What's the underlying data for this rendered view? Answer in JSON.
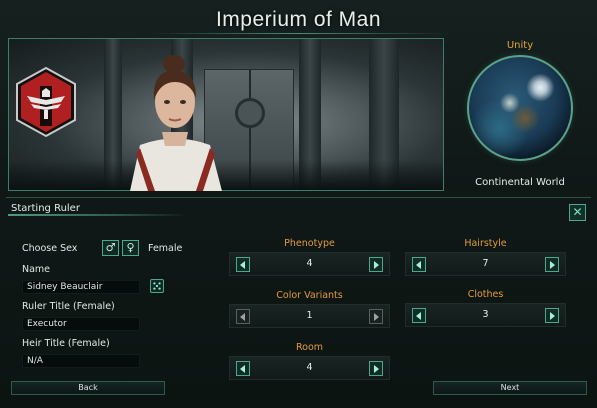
{
  "window": {
    "title": "Imperium of Man"
  },
  "planet": {
    "name": "Unity",
    "type": "Continental World"
  },
  "section": {
    "title": "Starting Ruler",
    "close_label": "✕"
  },
  "sex": {
    "label": "Choose Sex",
    "male_symbol": "♂",
    "female_symbol": "♀",
    "selected": "Female"
  },
  "fields": {
    "name": {
      "label": "Name",
      "value": "Sidney Beauclair"
    },
    "ruler_title": {
      "label": "Ruler Title (Female)",
      "value": "Executor"
    },
    "heir_title": {
      "label": "Heir Title (Female)",
      "value": "N/A"
    }
  },
  "selectors": {
    "phenotype": {
      "label": "Phenotype",
      "value": "4"
    },
    "hairstyle": {
      "label": "Hairstyle",
      "value": "7"
    },
    "color_variants": {
      "label": "Color Variants",
      "value": "1"
    },
    "clothes": {
      "label": "Clothes",
      "value": "3"
    },
    "room": {
      "label": "Room",
      "value": "4"
    }
  },
  "buttons": {
    "back": "Back",
    "next": "Next"
  },
  "colors": {
    "accent": "#4ea88a",
    "label_orange": "#e39a3d",
    "emblem_red": "#b02020"
  }
}
